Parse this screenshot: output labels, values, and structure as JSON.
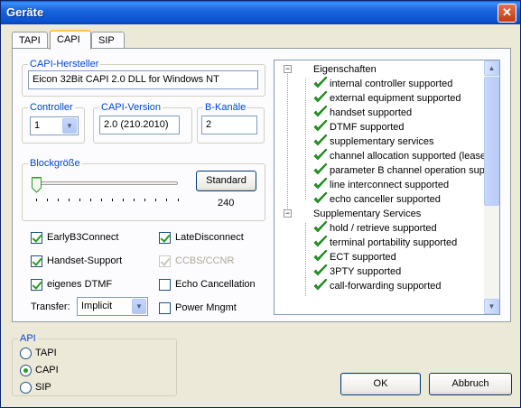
{
  "window": {
    "title": "Geräte"
  },
  "tabs": [
    {
      "label": "TAPI"
    },
    {
      "label": "CAPI"
    },
    {
      "label": "SIP"
    }
  ],
  "capi": {
    "hersteller_label": "CAPI-Hersteller",
    "hersteller_value": "Eicon 32Bit CAPI 2.0 DLL for Windows NT",
    "controller_label": "Controller",
    "controller_value": "1",
    "version_label": "CAPI-Version",
    "version_value": "2.0 (210.2010)",
    "bkanaele_label": "B-Kanäle",
    "bkanaele_value": "2",
    "blockgroesse_label": "Blockgröße",
    "standard_button": "Standard",
    "block_value": "240",
    "block_fraction": 0.0
  },
  "checkboxes": {
    "early_b3": {
      "label": "EarlyB3Connect",
      "checked": true
    },
    "late_disconnect": {
      "label": "LateDisconnect",
      "checked": true
    },
    "handset_support": {
      "label": "Handset-Support",
      "checked": true
    },
    "ccbs_ccnr": {
      "label": "CCBS/CCNR",
      "checked": true
    },
    "eigenes_dtmf": {
      "label": "eigenes DTMF",
      "checked": true
    },
    "echo_cancellation": {
      "label": "Echo Cancellation",
      "checked": false
    },
    "power_mngmt": {
      "label": "Power Mngmt",
      "checked": false
    }
  },
  "transfer": {
    "label": "Transfer:",
    "value": "Implicit"
  },
  "tree": {
    "groups": [
      {
        "label": "Eigenschaften",
        "items": [
          "internal controller supported",
          "external equipment supported",
          "handset supported",
          "DTMF supported",
          "supplementary services",
          "channel allocation supported (lease",
          "parameter B channel operation sup",
          "line interconnect supported",
          "echo canceller supported"
        ]
      },
      {
        "label": "Supplementary Services",
        "items": [
          "hold / retrieve supported",
          "terminal portability supported",
          "ECT supported",
          "3PTY supported",
          "call-forwarding supported"
        ]
      }
    ]
  },
  "api": {
    "label": "API",
    "options": [
      {
        "label": "TAPI",
        "selected": false
      },
      {
        "label": "CAPI",
        "selected": true
      },
      {
        "label": "SIP",
        "selected": false
      }
    ]
  },
  "buttons": {
    "ok": "OK",
    "cancel": "Abbruch"
  },
  "colors": {
    "accent": "#0046d5",
    "check": "#21a121",
    "titlebar": "#0a52cf"
  }
}
